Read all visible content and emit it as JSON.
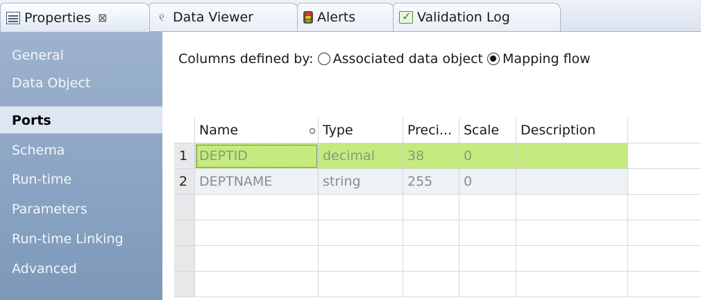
{
  "tabs": [
    {
      "label": "Properties",
      "icon": "properties-icon",
      "active": true,
      "close": "⊠"
    },
    {
      "label": "Data Viewer",
      "icon": "data-viewer-icon"
    },
    {
      "label": "Alerts",
      "icon": "alerts-icon"
    },
    {
      "label": "Validation Log",
      "icon": "validation-log-icon"
    }
  ],
  "nav": [
    "General",
    "Data Object",
    "Ports",
    "Schema",
    "Run-time",
    "Parameters",
    "Run-time Linking",
    "Advanced"
  ],
  "nav_selected": "Ports",
  "columns_defined": {
    "label": "Columns defined by:",
    "option1": "Associated data object",
    "option2": "Mapping flow",
    "selected": "Mapping flow"
  },
  "grid": {
    "headers": [
      "Name",
      "Type",
      "Preci...",
      "Scale",
      "Description"
    ],
    "rows": [
      {
        "num": "1",
        "name": "DEPTID",
        "type": "decimal",
        "precision": "38",
        "scale": "0",
        "description": ""
      },
      {
        "num": "2",
        "name": "DEPTNAME",
        "type": "string",
        "precision": "255",
        "scale": "0",
        "description": ""
      }
    ]
  },
  "colors": {
    "selected_row": "#c5ea7e",
    "nav_bg": "#8fa8c6"
  }
}
